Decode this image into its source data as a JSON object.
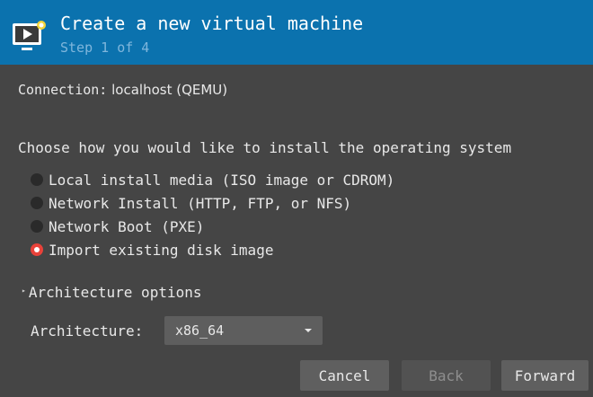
{
  "header": {
    "icon": "virtual-machine-screen-icon",
    "title": "Create a new virtual machine",
    "step": "Step 1 of 4",
    "color": "#0b72ae"
  },
  "connection": {
    "label": "Connection:",
    "value": "localhost (QEMU)"
  },
  "install": {
    "question": "Choose how you would like to install the operating system",
    "options": [
      {
        "label": "Local install media (ISO image or CDROM)",
        "checked": false
      },
      {
        "label": "Network Install (HTTP, FTP, or NFS)",
        "checked": false
      },
      {
        "label": "Network Boot (PXE)",
        "checked": false
      },
      {
        "label": "Import existing disk image",
        "checked": true
      }
    ]
  },
  "architecture": {
    "expander_label": "Architecture options",
    "expander_icon": "collapsed-arrow-icon",
    "field_label": "Architecture:",
    "selected": "x86_64"
  },
  "buttons": {
    "cancel": "Cancel",
    "back": "Back",
    "forward": "Forward"
  }
}
